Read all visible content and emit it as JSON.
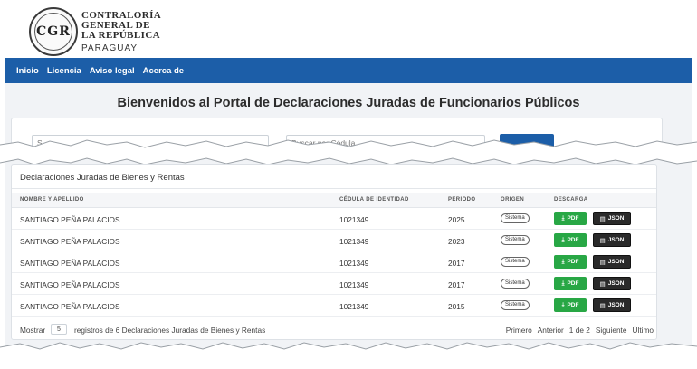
{
  "header": {
    "seal_text": "CGR",
    "org_lines": [
      "CONTRALORÍA",
      "GENERAL DE",
      "LA REPÚBLICA"
    ],
    "country": "PARAGUAY"
  },
  "nav": {
    "items": [
      "Inicio",
      "Licencia",
      "Aviso legal",
      "Acerca de"
    ]
  },
  "main": {
    "welcome": "Bienvenidos al Portal de Declaraciones Juradas de Funcionarios Públicos"
  },
  "search": {
    "name_placeholder": "S",
    "ci_placeholder": "Buscar por Cédula"
  },
  "table": {
    "title": "Declaraciones Juradas de Bienes y Rentas",
    "headers": [
      "Nombre y Apellido",
      "Cédula de Identidad",
      "Periodo",
      "Origen",
      "Descarga"
    ],
    "rows": [
      {
        "name": "SANTIAGO PEÑA PALACIOS",
        "ci": "1021349",
        "periodo": "2025",
        "origen": "Sistema"
      },
      {
        "name": "SANTIAGO PEÑA PALACIOS",
        "ci": "1021349",
        "periodo": "2023",
        "origen": "Sistema"
      },
      {
        "name": "SANTIAGO PEÑA PALACIOS",
        "ci": "1021349",
        "periodo": "2017",
        "origen": "Sistema"
      },
      {
        "name": "SANTIAGO PEÑA PALACIOS",
        "ci": "1021349",
        "periodo": "2017",
        "origen": "Sistema"
      },
      {
        "name": "SANTIAGO PEÑA PALACIOS",
        "ci": "1021349",
        "periodo": "2015",
        "origen": "Sistema"
      }
    ],
    "pdf_label": "PDF",
    "json_label": "JSON"
  },
  "footer": {
    "show_label": "Mostrar",
    "page_length": "5",
    "info": "registros de 6 Declaraciones Juradas de Bienes y Rentas",
    "pager": [
      "Primero",
      "Anterior",
      "1 de 2",
      "Siguiente",
      "Último"
    ]
  },
  "colors": {
    "navbar": "#1c5ea8",
    "pdf_button": "#28a745",
    "json_button": "#2a2a2a"
  }
}
